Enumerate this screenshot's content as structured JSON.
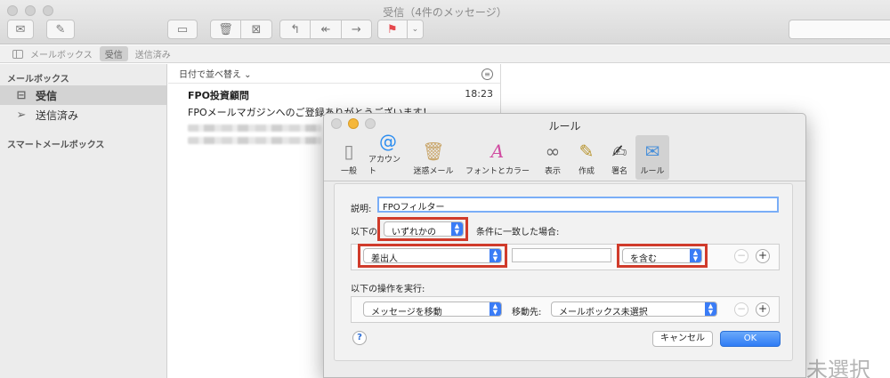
{
  "window": {
    "title": "受信（4件のメッセージ）"
  },
  "toolbar": {
    "get_mail_icon": "envelope-icon",
    "compose_icon": "compose-icon",
    "archive_icon": "archive-icon",
    "delete_icon": "trash-icon",
    "junk_icon": "junk-icon",
    "reply_icon": "reply-icon",
    "reply_all_icon": "reply-all-icon",
    "forward_icon": "forward-icon",
    "flag_icon": "flag-icon",
    "flag_color": "#e5484d"
  },
  "favorites": {
    "mailboxes_label": "メールボックス",
    "inbox_label": "受信",
    "sent_label": "送信済み"
  },
  "sidebar": {
    "header": "メールボックス",
    "items": [
      {
        "label": "受信",
        "icon": "inbox-icon",
        "selected": true
      },
      {
        "label": "送信済み",
        "icon": "paper-plane-icon",
        "selected": false
      }
    ],
    "smart_header": "スマートメールボックス"
  },
  "messages": {
    "sort_label": "日付で並べ替え ⌄",
    "items": [
      {
        "from": "FPO投資顧問",
        "time": "18:23",
        "subject": "FPOメールマガジンへのご登録ありがとうございます！"
      }
    ]
  },
  "preview": {
    "no_selection": "未選択"
  },
  "dialog": {
    "title": "ルール",
    "tabs": [
      {
        "label": "一般",
        "icon": "switch-icon",
        "glyph": "▯"
      },
      {
        "label": "アカウント",
        "icon": "at-icon",
        "glyph": "@"
      },
      {
        "label": "迷惑メール",
        "icon": "junk-bin-icon",
        "glyph": "🗑"
      },
      {
        "label": "フォントとカラー",
        "icon": "font-icon",
        "glyph": "A"
      },
      {
        "label": "表示",
        "icon": "glasses-icon",
        "glyph": "∞"
      },
      {
        "label": "作成",
        "icon": "pencil-icon",
        "glyph": "✎"
      },
      {
        "label": "署名",
        "icon": "signature-icon",
        "glyph": "✍"
      },
      {
        "label": "ルール",
        "icon": "rules-icon",
        "glyph": "✉",
        "active": true
      }
    ],
    "description_label": "説明:",
    "description_value": "FPOフィルター",
    "if_prefix": "以下の",
    "if_selector": "いずれかの",
    "if_suffix": "条件に一致した場合:",
    "condition": {
      "field": "差出人",
      "value": "",
      "operator": "を含む"
    },
    "action_label": "以下の操作を実行:",
    "action": {
      "type": "メッセージを移動",
      "target_label": "移動先:",
      "target": "メールボックス未選択"
    },
    "cancel_label": "キャンセル",
    "ok_label": "OK",
    "help_label": "?",
    "highlight_color": "#d03b2b",
    "accent_color": "#3a7cf6"
  }
}
